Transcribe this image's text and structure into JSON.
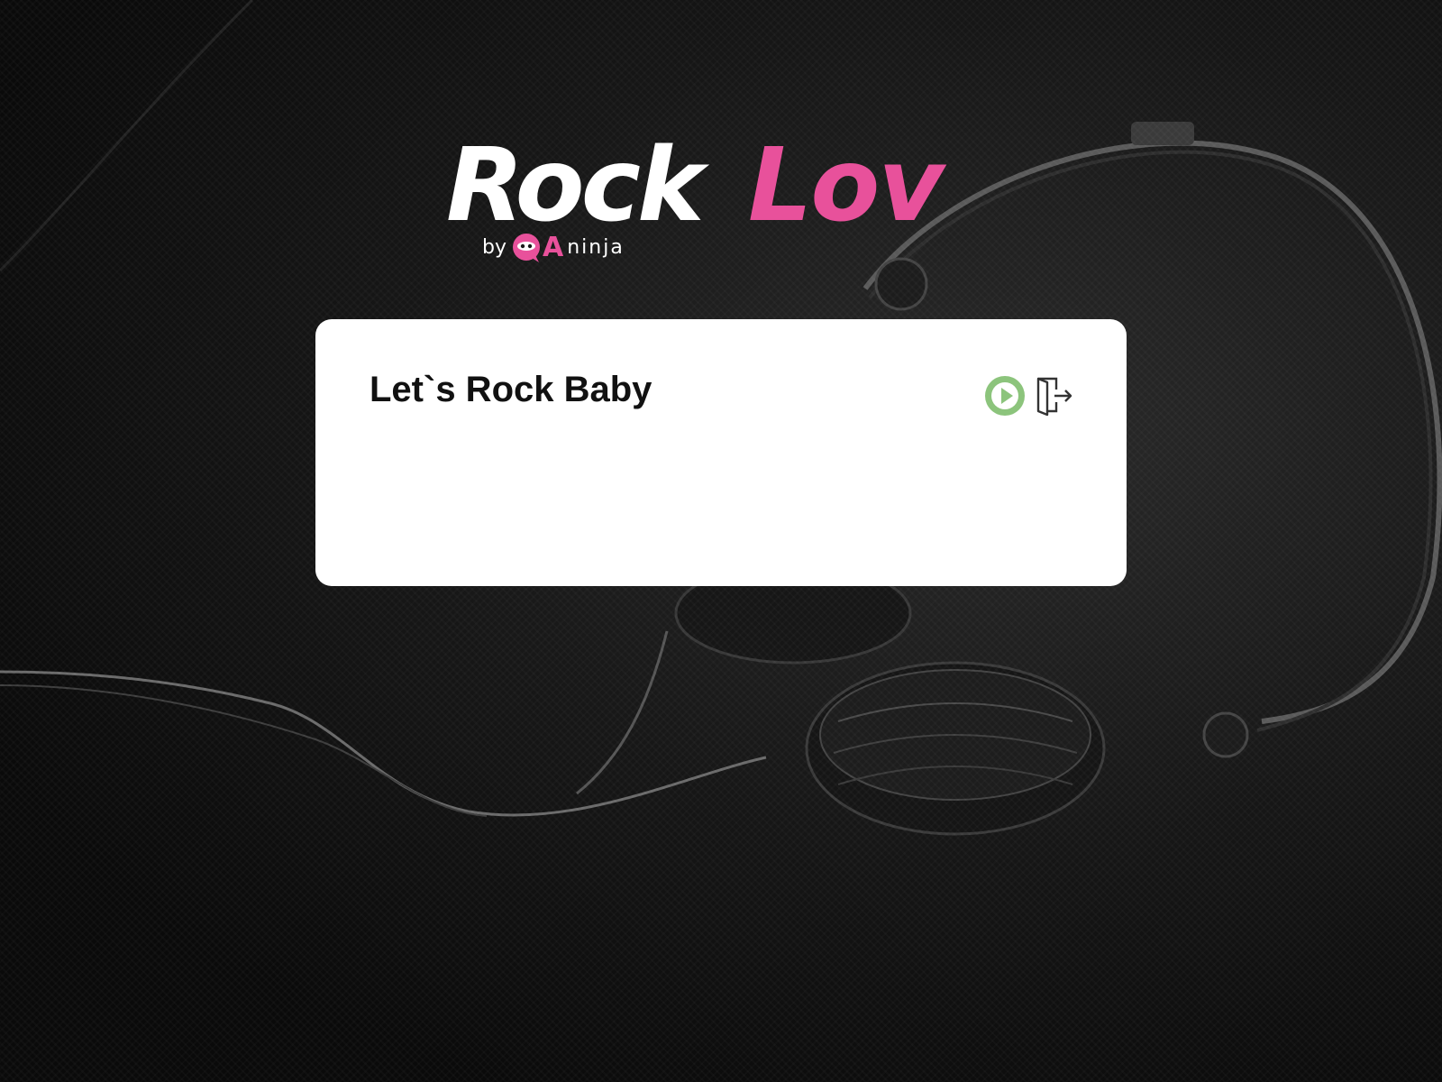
{
  "brand": {
    "name_part1": "Rock",
    "name_part2": "Lov",
    "by_label": "by",
    "sub_brand_a": "A",
    "sub_brand_ninja": "ninja",
    "accent_color": "#e8519b"
  },
  "card": {
    "title": "Let`s Rock Baby"
  },
  "actions": {
    "play_icon": "play-icon",
    "play_color": "#8cc47c",
    "logout_icon": "logout-icon"
  },
  "background": {
    "description_icon": "headphones-image"
  }
}
